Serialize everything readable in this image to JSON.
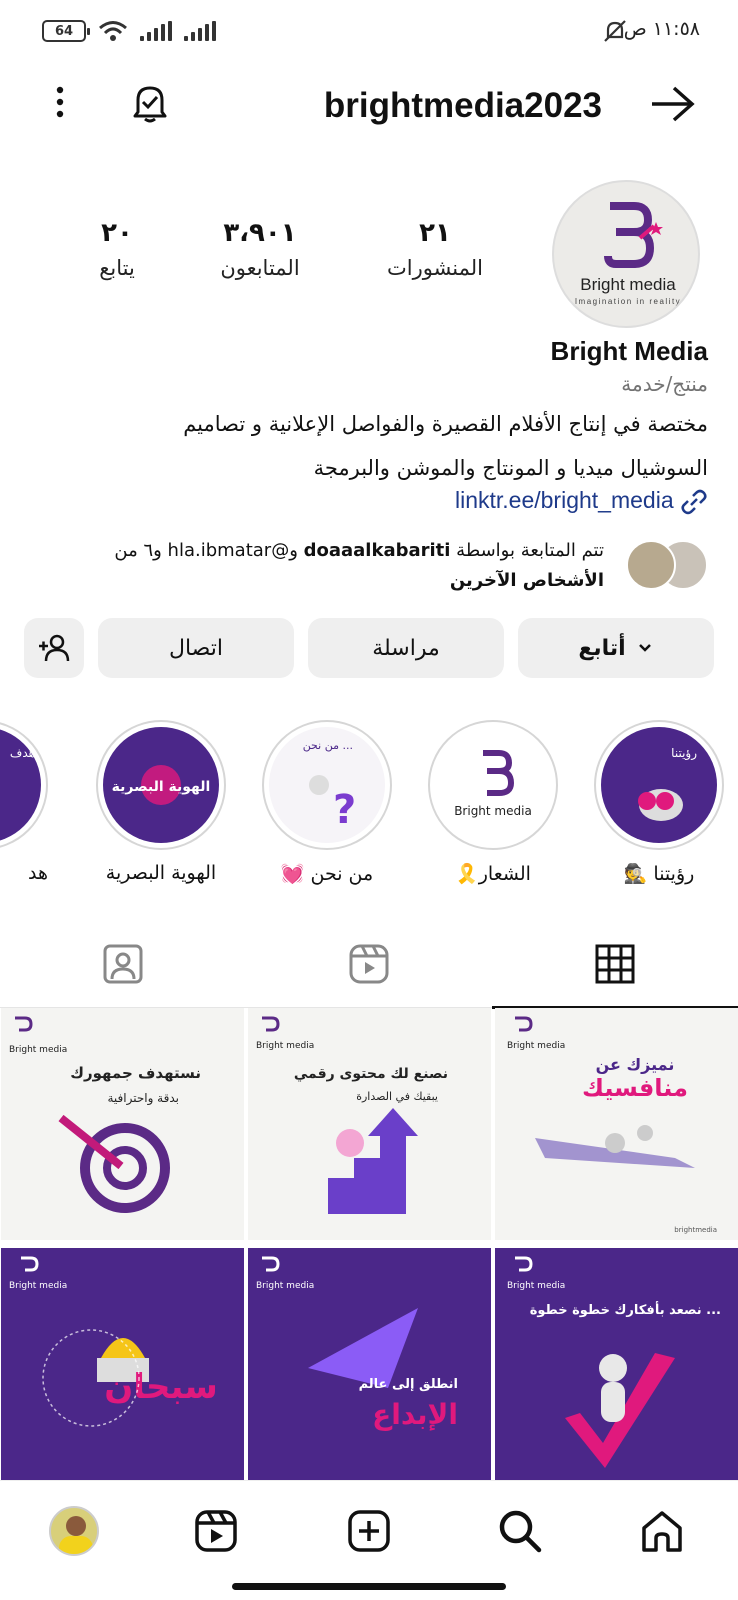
{
  "status_bar": {
    "time": "١١:٥٨ ص",
    "battery": "64"
  },
  "header": {
    "username": "brightmedia2023"
  },
  "profile": {
    "avatar_logo_text": "Bright media",
    "avatar_tagline": "Imagination in reality",
    "stats": [
      {
        "number": "٢١",
        "label": "المنشورات"
      },
      {
        "number": "٣،٩٠١",
        "label": "المتابعون"
      },
      {
        "number": "٢٠",
        "label": "يتابع"
      }
    ],
    "name": "Bright Media",
    "category": "منتج/خدمة",
    "bio_line1": "مختصة في إنتاج الأفلام القصيرة والفواصل الإعلانية و تصاميم",
    "bio_line2": "السوشيال ميديا و المونتاج والموشن والبرمجة",
    "link": "linktr.ee/bright_media"
  },
  "followed_by": {
    "prefix": "تتم المتابعة بواسطة ",
    "user1": "doaaalkabariti",
    "middle": " و@hla.ibmatar و٦ من",
    "line2": "الأشخاص الآخرين"
  },
  "actions": {
    "follow": "أتابع",
    "message": "مراسلة",
    "contact": "اتصال"
  },
  "highlights": [
    {
      "label": "رؤيتنا 🕵️",
      "cover_text": "رؤيتنا"
    },
    {
      "label": "الشعار🎗️",
      "cover_text": "Bright media"
    },
    {
      "label": "من نحن 💓",
      "cover_text": "من نحن ..."
    },
    {
      "label": "الهوية البصرية",
      "cover_text": "الهوية البصرية"
    },
    {
      "label": "هد",
      "cover_text": "هدف"
    }
  ],
  "posts": [
    {
      "headline": "نميزك عن",
      "big": "منافسيك",
      "brand": "Bright media"
    },
    {
      "headline": "نصنع لك محتوى رقمي",
      "sub": "يبقيك في الصدارة",
      "brand": "Bright media"
    },
    {
      "headline": "نستهدف جمهورك",
      "sub": "بدقة واحترافية",
      "brand": "Bright media"
    },
    {
      "headline": "نصعد بأفكارك خطوة خطوة ...",
      "brand": "Bright media"
    },
    {
      "headline": "انطلق إلى عالم",
      "big": "الإبداع",
      "brand": "Bright media"
    },
    {
      "big": "سبحان",
      "brand": "Bright media"
    }
  ],
  "colors": {
    "brand_purple": "#4b2789",
    "brand_pink": "#e0197d",
    "link_blue": "#1e3a8a"
  }
}
